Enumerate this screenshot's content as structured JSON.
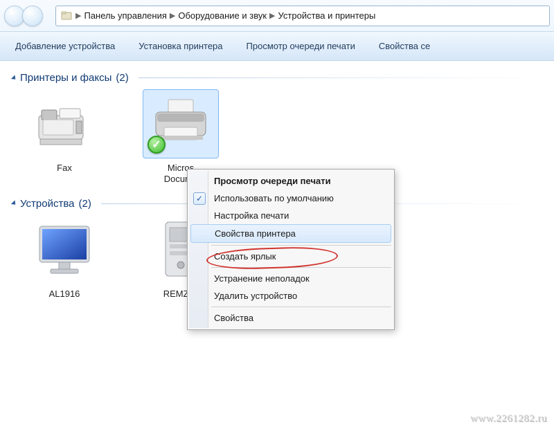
{
  "breadcrumb": {
    "items": [
      "Панель управления",
      "Оборудование и звук",
      "Устройства и принтеры"
    ]
  },
  "toolbar": {
    "add_device": "Добавление устройства",
    "add_printer": "Установка принтера",
    "view_queue": "Просмотр очереди печати",
    "properties": "Свойства се"
  },
  "groups": {
    "printers": {
      "title": "Принтеры и факсы",
      "count": "(2)"
    },
    "devices": {
      "title": "Устройства",
      "count": "(2)"
    }
  },
  "printer_items": [
    {
      "label": "Fax"
    },
    {
      "label": "Microsoft XPS Document Writer",
      "label_truncated": "Micros\nDocume"
    }
  ],
  "device_items": [
    {
      "label": "AL1916"
    },
    {
      "label": "REMZOI",
      "label_truncated": "REMZOI"
    }
  ],
  "context_menu": {
    "view_queue": "Просмотр очереди печати",
    "set_default": "Использовать по умолчанию",
    "print_prefs": "Настройка печати",
    "printer_props": "Свойства принтера",
    "create_shortcut": "Создать ярлык",
    "troubleshoot": "Устранение неполадок",
    "remove_device": "Удалить устройство",
    "properties": "Свойства"
  },
  "watermark": "www.2261282.ru"
}
